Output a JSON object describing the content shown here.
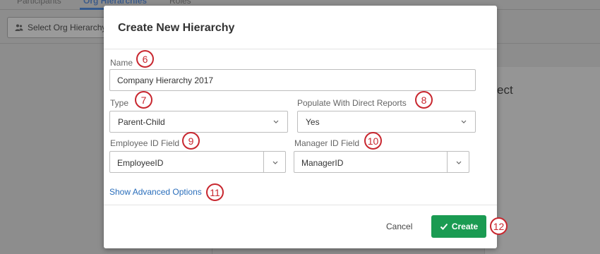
{
  "background": {
    "tabs": [
      {
        "label": "Participants",
        "active": false
      },
      {
        "label": "Org Hierarchies",
        "active": true
      },
      {
        "label": "Roles",
        "active": false
      }
    ],
    "select_button_label": "Select Org Hierarchy",
    "panel_text": "ect"
  },
  "modal": {
    "title": "Create New Hierarchy",
    "name": {
      "label": "Name",
      "value": "Company Hierarchy 2017",
      "step": "6"
    },
    "type": {
      "label": "Type",
      "value": "Parent-Child",
      "step": "7"
    },
    "populate": {
      "label": "Populate With Direct Reports",
      "value": "Yes",
      "step": "8"
    },
    "employee_id": {
      "label": "Employee ID Field",
      "value": "EmployeeID",
      "step": "9"
    },
    "manager_id": {
      "label": "Manager ID Field",
      "value": "ManagerID",
      "step": "10"
    },
    "advanced": {
      "label": "Show Advanced Options",
      "step": "11"
    },
    "footer": {
      "cancel_label": "Cancel",
      "create_label": "Create",
      "create_step": "12"
    }
  },
  "colors": {
    "accent": "#1a9b52",
    "link": "#2a6ebb",
    "badge": "#c8272f"
  }
}
